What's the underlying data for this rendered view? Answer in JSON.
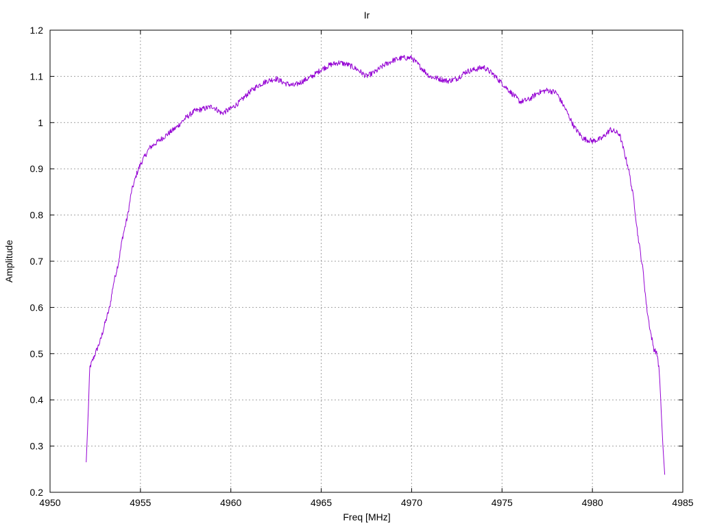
{
  "chart_data": {
    "type": "line",
    "title": "Ir",
    "xlabel": "Freq [MHz]",
    "ylabel": "Amplitude",
    "xlim": [
      4950,
      4985
    ],
    "ylim": [
      0.2,
      1.2
    ],
    "x_ticks": [
      4950,
      4955,
      4960,
      4965,
      4970,
      4975,
      4980,
      4985
    ],
    "y_ticks": [
      0.2,
      0.3,
      0.4,
      0.5,
      0.6,
      0.7,
      0.8,
      0.9,
      1,
      1.1,
      1.2
    ],
    "y_tick_labels": [
      "0.2",
      "0.3",
      "0.4",
      "0.5",
      "0.6",
      "0.7",
      "0.8",
      "0.9",
      "1",
      "1.1",
      "1.2"
    ],
    "grid": true,
    "legend": "none",
    "series": [
      {
        "color": "#9400d3",
        "x": [
          4952.0,
          4952.1,
          4952.2,
          4952.3,
          4952.5,
          4952.8,
          4953.0,
          4953.3,
          4953.5,
          4953.8,
          4954.0,
          4954.3,
          4954.5,
          4954.8,
          4955.0,
          4955.5,
          4956.0,
          4956.5,
          4957.0,
          4957.5,
          4958.0,
          4958.5,
          4959.0,
          4959.5,
          4960.0,
          4960.5,
          4961.0,
          4961.5,
          4962.0,
          4962.5,
          4963.0,
          4963.5,
          4964.0,
          4964.5,
          4965.0,
          4965.5,
          4966.0,
          4966.5,
          4967.0,
          4967.5,
          4968.0,
          4968.5,
          4969.0,
          4969.5,
          4970.0,
          4970.5,
          4971.0,
          4971.5,
          4972.0,
          4972.5,
          4973.0,
          4973.5,
          4974.0,
          4974.5,
          4975.0,
          4975.5,
          4976.0,
          4976.5,
          4977.0,
          4977.5,
          4978.0,
          4978.5,
          4979.0,
          4979.5,
          4980.0,
          4980.5,
          4981.0,
          4981.5,
          4982.0,
          4982.3,
          4982.5,
          4982.8,
          4983.0,
          4983.2,
          4983.4,
          4983.5,
          4983.6,
          4983.7,
          4983.8,
          4983.9,
          4984.0
        ],
        "y": [
          0.265,
          0.36,
          0.47,
          0.48,
          0.5,
          0.53,
          0.56,
          0.6,
          0.65,
          0.7,
          0.75,
          0.8,
          0.85,
          0.89,
          0.91,
          0.945,
          0.96,
          0.975,
          0.99,
          1.01,
          1.025,
          1.03,
          1.035,
          1.02,
          1.03,
          1.045,
          1.065,
          1.08,
          1.09,
          1.095,
          1.085,
          1.08,
          1.09,
          1.1,
          1.115,
          1.125,
          1.13,
          1.125,
          1.115,
          1.1,
          1.11,
          1.125,
          1.135,
          1.14,
          1.14,
          1.12,
          1.1,
          1.095,
          1.09,
          1.095,
          1.11,
          1.115,
          1.12,
          1.105,
          1.085,
          1.065,
          1.045,
          1.05,
          1.065,
          1.07,
          1.065,
          1.03,
          0.99,
          0.965,
          0.96,
          0.965,
          0.985,
          0.975,
          0.9,
          0.83,
          0.76,
          0.68,
          0.6,
          0.55,
          0.51,
          0.505,
          0.495,
          0.46,
          0.38,
          0.3,
          0.238
        ]
      }
    ]
  }
}
